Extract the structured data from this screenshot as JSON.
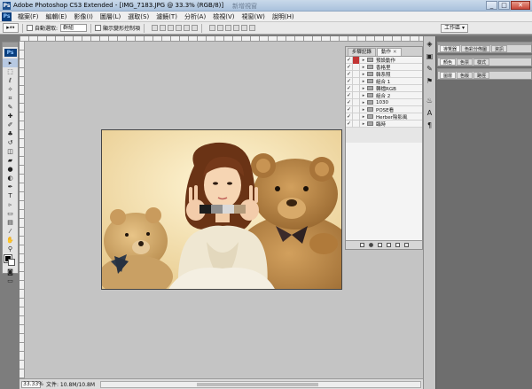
{
  "window": {
    "app_icon": "Ps",
    "title": "Adobe Photoshop CS3 Extended - [IMG_7183.JPG @ 33.3% (RGB/8)]",
    "faint_caption": "新增視窗",
    "controls": [
      "_",
      "□",
      "✕"
    ]
  },
  "menubar": {
    "logo": "Ps",
    "items": [
      "檔案(F)",
      "編輯(E)",
      "影像(I)",
      "圖層(L)",
      "選取(S)",
      "濾鏡(T)",
      "分析(A)",
      "檢視(V)",
      "視窗(W)",
      "說明(H)"
    ]
  },
  "options_bar": {
    "tool_preset": "▸↔",
    "auto_select_label": "自動選取:",
    "auto_select_value": "群組",
    "transform_label": "顯示變形控制項",
    "workspace_label": "工作區 ▾"
  },
  "toolbox": {
    "badge": "Ps",
    "tools": [
      {
        "name": "move-tool-icon",
        "glyph": "▸",
        "active": true
      },
      {
        "name": "marquee-tool-icon",
        "glyph": "⬚"
      },
      {
        "name": "lasso-tool-icon",
        "glyph": "ℓ"
      },
      {
        "name": "magic-wand-tool-icon",
        "glyph": "✧"
      },
      {
        "name": "crop-tool-icon",
        "glyph": "⌗"
      },
      {
        "name": "eyedropper-tool-icon",
        "glyph": "✎"
      },
      {
        "name": "healing-brush-tool-icon",
        "glyph": "✚"
      },
      {
        "name": "brush-tool-icon",
        "glyph": "✐"
      },
      {
        "name": "clone-stamp-tool-icon",
        "glyph": "♣"
      },
      {
        "name": "history-brush-tool-icon",
        "glyph": "↺"
      },
      {
        "name": "eraser-tool-icon",
        "glyph": "◫"
      },
      {
        "name": "gradient-tool-icon",
        "glyph": "▰"
      },
      {
        "name": "blur-tool-icon",
        "glyph": "●"
      },
      {
        "name": "dodge-tool-icon",
        "glyph": "◐"
      },
      {
        "name": "pen-tool-icon",
        "glyph": "✒"
      },
      {
        "name": "type-tool-icon",
        "glyph": "T"
      },
      {
        "name": "path-selection-tool-icon",
        "glyph": "▹"
      },
      {
        "name": "shape-tool-icon",
        "glyph": "▭"
      },
      {
        "name": "notes-tool-icon",
        "glyph": "▤"
      },
      {
        "name": "eyedropper-sample-tool-icon",
        "glyph": "⁄"
      },
      {
        "name": "hand-tool-icon",
        "glyph": "✋"
      },
      {
        "name": "zoom-tool-icon",
        "glyph": "⚲"
      }
    ],
    "bottom_tools": [
      {
        "name": "quick-mask-icon",
        "glyph": "◙"
      },
      {
        "name": "screen-mode-icon",
        "glyph": "▭"
      }
    ]
  },
  "status": {
    "zoom": "33.33%",
    "doc_info": "文件: 10.8M/10.8M"
  },
  "actions_panel": {
    "tabs": [
      "步驟記錄",
      "動作"
    ],
    "rows": [
      {
        "label": "預設動作",
        "checked": true,
        "dialog": "red"
      },
      {
        "label": "香格里",
        "checked": true,
        "dialog": ""
      },
      {
        "label": "韓系照",
        "checked": true,
        "dialog": ""
      },
      {
        "label": "組合 1",
        "checked": true,
        "dialog": ""
      },
      {
        "label": "轉檔RGB",
        "checked": true,
        "dialog": ""
      },
      {
        "label": "組合 2",
        "checked": true,
        "dialog": ""
      },
      {
        "label": "1030",
        "checked": true,
        "dialog": ""
      },
      {
        "label": "POSE看",
        "checked": true,
        "dialog": ""
      },
      {
        "label": "Herber陰影風",
        "checked": true,
        "dialog": ""
      },
      {
        "label": "臨時",
        "checked": true,
        "dialog": ""
      }
    ],
    "check_glyph": "✓",
    "triangle_glyph": "▸"
  },
  "icon_dock": {
    "icons": [
      {
        "name": "layers-panel-icon",
        "glyph": "◈"
      },
      {
        "name": "channels-panel-icon",
        "glyph": "▣"
      },
      {
        "name": "brush-panel-icon",
        "glyph": "✎"
      },
      {
        "name": "tool-presets-icon",
        "glyph": "⚑"
      },
      {
        "name": "clone-source-icon",
        "glyph": "♨"
      },
      {
        "name": "character-panel-icon",
        "glyph": "A"
      },
      {
        "name": "paragraph-panel-icon",
        "glyph": "¶"
      }
    ]
  },
  "right_dock": {
    "panels": [
      {
        "tabs": [
          "導覽器",
          "色彩分佈圖",
          "資訊"
        ]
      },
      {
        "tabs": [
          "顏色",
          "色票",
          "樣式"
        ]
      },
      {
        "tabs": [
          "圖層",
          "色版",
          "路徑"
        ]
      }
    ]
  }
}
